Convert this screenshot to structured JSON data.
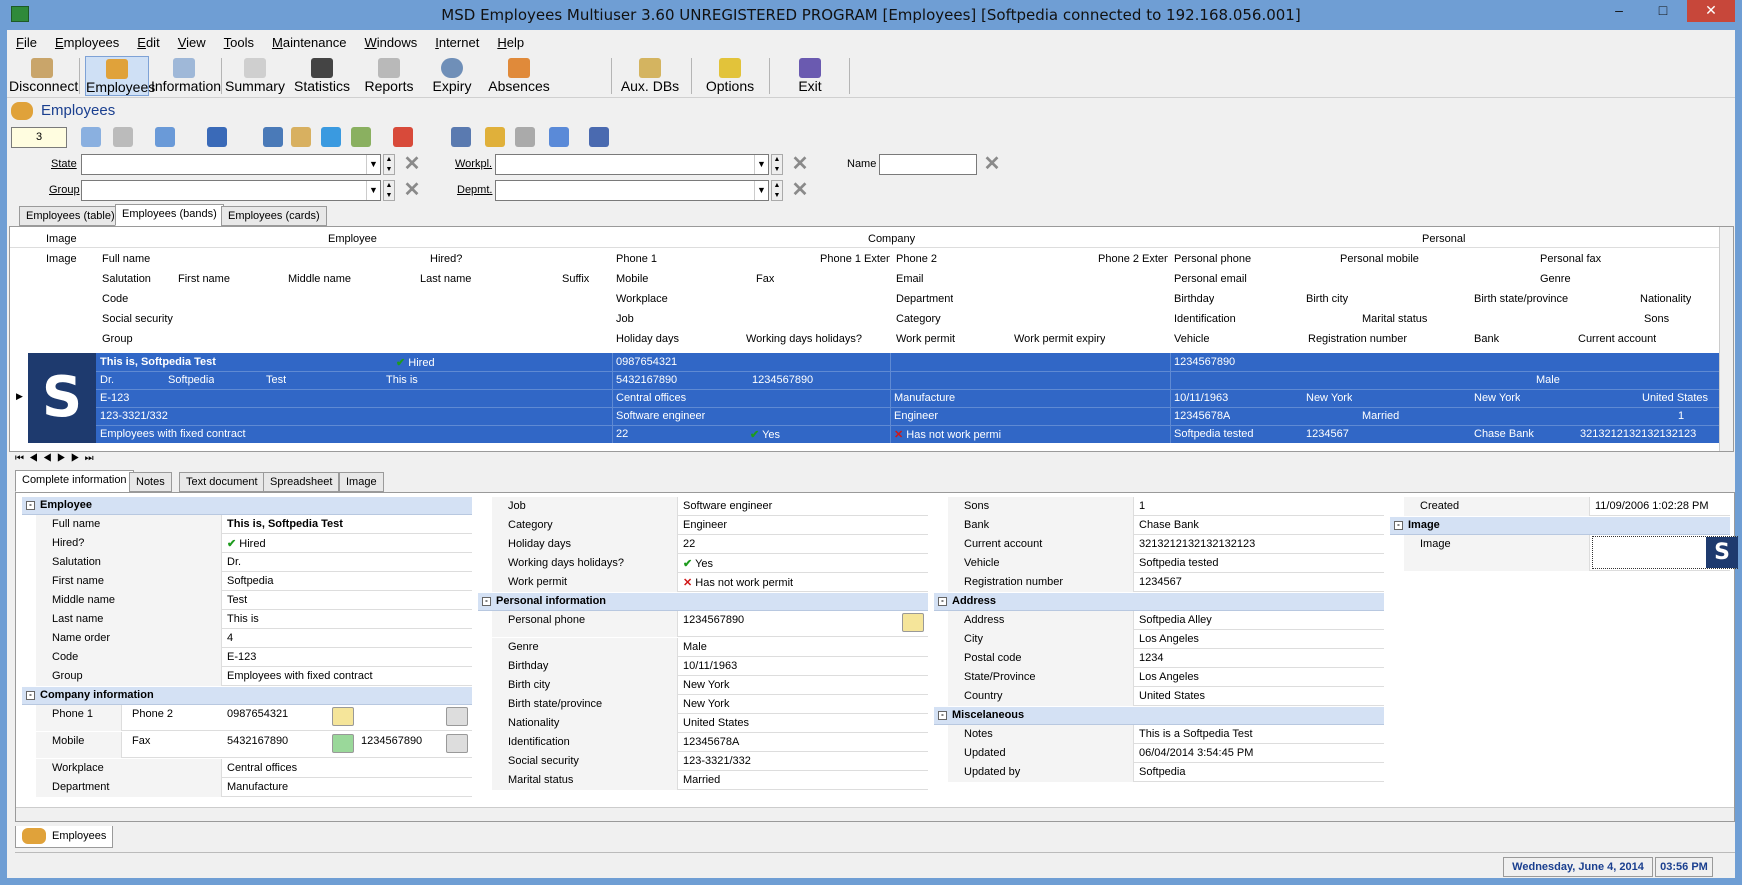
{
  "window": {
    "title": "MSD Employees Multiuser 3.60 UNREGISTERED PROGRAM [Employees] [Softpedia connected to 192.168.056.001]",
    "min": "–",
    "max": "□",
    "close": "✕"
  },
  "menu": [
    "File",
    "Employees",
    "Edit",
    "View",
    "Tools",
    "Maintenance",
    "Windows",
    "Internet",
    "Help"
  ],
  "toolbar": [
    "Disconnect",
    "Employees",
    "Information",
    "Summary",
    "Statistics",
    "Reports",
    "Expiry",
    "Absences",
    "Aux. DBs",
    "Options",
    "Exit"
  ],
  "section_title": "Employees",
  "counter": "3",
  "filters": {
    "state": "State",
    "workpl": "Workpl.",
    "name": "Name",
    "group": "Group",
    "depmt": "Depmt."
  },
  "grid_tabs": [
    "Employees (table)",
    "Employees (bands)",
    "Employees (cards)"
  ],
  "bands": {
    "image": "Image",
    "employee": "Employee",
    "company": "Company",
    "personal": "Personal"
  },
  "headers": {
    "r1": [
      "Image",
      "Full name",
      "Hired?",
      "Phone 1",
      "Phone 1 Exten",
      "Phone 2",
      "Phone 2 Exten",
      "Personal phone",
      "Personal mobile",
      "Personal fax"
    ],
    "r2": [
      "Salutation",
      "First name",
      "Middle name",
      "Last name",
      "Suffix",
      "Mobile",
      "Fax",
      "Email",
      "Personal email",
      "Genre"
    ],
    "r3": [
      "Code",
      "Workplace",
      "Department",
      "Birthday",
      "Birth city",
      "Birth state/province",
      "Nationality"
    ],
    "r4": [
      "Social security",
      "Job",
      "Category",
      "Identification",
      "Marital status",
      "Sons"
    ],
    "r5": [
      "Group",
      "Holiday days",
      "Working days holidays?",
      "Work permit",
      "Work permit expiry",
      "Vehicle",
      "Registration number",
      "Bank",
      "Current account"
    ]
  },
  "record": {
    "full_name": "This is, Softpedia Test",
    "hired": "Hired",
    "phone1": "0987654321",
    "personal_phone": "1234567890",
    "salutation": "Dr.",
    "first_name": "Softpedia",
    "middle_name": "Test",
    "last_name": "This is",
    "mobile": "5432167890",
    "fax": "1234567890",
    "genre": "Male",
    "code": "E-123",
    "workplace": "Central offices",
    "department": "Manufacture",
    "birthday": "10/11/1963",
    "birth_city": "New York",
    "birth_state": "New York",
    "nationality": "United States",
    "social_security": "123-3321/332",
    "job": "Software engineer",
    "category": "Engineer",
    "identification": "12345678A",
    "marital": "Married",
    "sons": "1",
    "group": "Employees with fixed contract",
    "holiday_days": "22",
    "working_days_holidays": "Yes",
    "work_permit": "Has not work permi",
    "vehicle": "Softpedia tested",
    "registration": "1234567",
    "bank": "Chase Bank",
    "current_account": "3213212132132132123"
  },
  "logo_letter": "S",
  "detail_tabs": [
    "Complete information",
    "Notes",
    "Text document",
    "Spreadsheet",
    "Image"
  ],
  "detail": {
    "employee_group": "Employee",
    "employee": [
      [
        "Full name",
        "This is, Softpedia Test"
      ],
      [
        "Hired?",
        "Hired"
      ],
      [
        "Salutation",
        "Dr."
      ],
      [
        "First name",
        "Softpedia"
      ],
      [
        "Middle name",
        "Test"
      ],
      [
        "Last name",
        "This is"
      ],
      [
        "Name order",
        "4"
      ],
      [
        "Code",
        "E-123"
      ],
      [
        "Group",
        "Employees with fixed contract"
      ]
    ],
    "company_group": "Company information",
    "company": {
      "phone1_label": "Phone 1",
      "phone1": "0987654321",
      "phone2_label": "Phone 2",
      "mobile_label": "Mobile",
      "mobile": "5432167890",
      "fax_label": "Fax",
      "fax": "1234567890",
      "workplace_label": "Workplace",
      "workplace": "Central offices",
      "department_label": "Department",
      "department": "Manufacture"
    },
    "job_rows": [
      [
        "Job",
        "Software engineer"
      ],
      [
        "Category",
        "Engineer"
      ],
      [
        "Holiday days",
        "22"
      ],
      [
        "Working days holidays?",
        "Yes"
      ],
      [
        "Work permit",
        "Has not work permit"
      ]
    ],
    "personal_group": "Personal information",
    "personal": [
      [
        "Personal phone",
        "1234567890"
      ],
      [
        "Genre",
        "Male"
      ],
      [
        "Birthday",
        "10/11/1963"
      ],
      [
        "Birth city",
        "New York"
      ],
      [
        "Birth state/province",
        "New York"
      ],
      [
        "Nationality",
        "United States"
      ],
      [
        "Identification",
        "12345678A"
      ],
      [
        "Social security",
        "123-3321/332"
      ],
      [
        "Marital status",
        "Married"
      ]
    ],
    "col3_rows": [
      [
        "Sons",
        "1"
      ],
      [
        "Bank",
        "Chase Bank"
      ],
      [
        "Current account",
        "3213212132132132123"
      ],
      [
        "Vehicle",
        "Softpedia tested"
      ],
      [
        "Registration number",
        "1234567"
      ]
    ],
    "address_group": "Address",
    "address": [
      [
        "Address",
        "Softpedia Alley"
      ],
      [
        "City",
        "Los Angeles"
      ],
      [
        "Postal code",
        "1234"
      ],
      [
        "State/Province",
        "Los Angeles"
      ],
      [
        "Country",
        "United States"
      ]
    ],
    "misc_group": "Miscelaneous",
    "misc": [
      [
        "Notes",
        "This is a Softpedia Test"
      ],
      [
        "Updated",
        "06/04/2014 3:54:45 PM"
      ],
      [
        "Updated by",
        "Softpedia"
      ]
    ],
    "created_label": "Created",
    "created": "11/09/2006 1:02:28 PM",
    "image_group": "Image",
    "image_label": "Image"
  },
  "bottom_tab": "Employees",
  "status": {
    "date": "Wednesday, June 4, 2014",
    "time": "03:56 PM"
  },
  "colors": {
    "titlebar": "#6f9ed4",
    "selection": "#3167c6",
    "group": "#d4e1f4"
  }
}
